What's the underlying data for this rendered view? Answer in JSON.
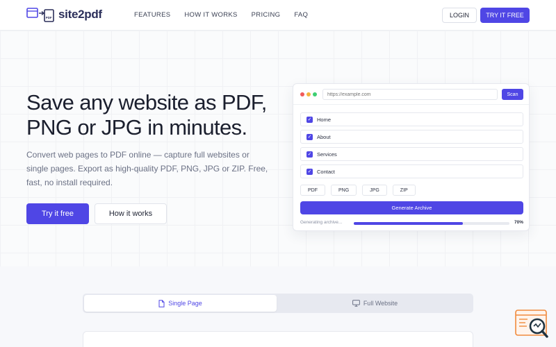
{
  "brand": {
    "name": "site2pdf"
  },
  "nav": {
    "items": [
      "FEATURES",
      "HOW IT WORKS",
      "PRICING",
      "FAQ"
    ]
  },
  "header": {
    "login_label": "LOGIN",
    "try_label": "TRY IT FREE"
  },
  "hero": {
    "title_line1": "Save any website as PDF,",
    "title_line2": "PNG or JPG in minutes.",
    "subtitle": "Convert web pages to PDF online — capture full websites or single pages. Export as high-quality PDF, PNG, JPG or ZIP. Free, fast, no install required.",
    "primary_cta": "Try it free",
    "secondary_cta": "How it works"
  },
  "mock": {
    "url_placeholder": "https://example.com",
    "scan_label": "Scan",
    "pages": [
      "Home",
      "About",
      "Services",
      "Contact"
    ],
    "formats": [
      "PDF",
      "PNG",
      "JPG",
      "ZIP"
    ],
    "generate_label": "Generate Archive",
    "progress_label": "Generating archive...",
    "progress_value": "70%",
    "progress_fraction": 0.7
  },
  "tabs": {
    "single": "Single Page",
    "full": "Full Website"
  },
  "colors": {
    "accent": "#4f46e5",
    "dot_red": "#f05b5b",
    "dot_yellow": "#f4b43c",
    "dot_green": "#3ecf72",
    "widget_orange": "#f08a3c"
  }
}
